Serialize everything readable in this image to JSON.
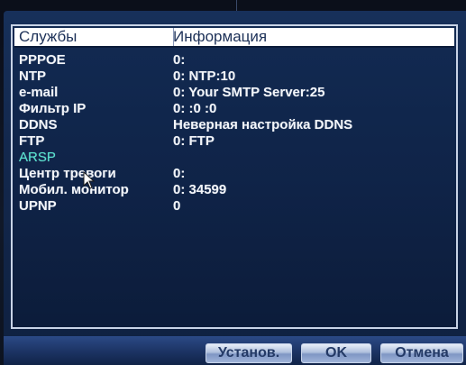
{
  "table": {
    "headers": {
      "service": "Службы",
      "info": "Информация"
    },
    "rows": [
      {
        "service": "PPPOE",
        "info": "0:"
      },
      {
        "service": "NTP",
        "info": "0: NTP:10"
      },
      {
        "service": "e-mail",
        "info": "0: Your SMTP Server:25"
      },
      {
        "service": "Фильтр IP",
        "info": "0: :0 :0"
      },
      {
        "service": "DDNS",
        "info": "Неверная настройка DDNS"
      },
      {
        "service": "FTP",
        "info": "0: FTP"
      },
      {
        "service": "ARSP",
        "info": ""
      },
      {
        "service": "Центр тревоги",
        "info": "0:"
      },
      {
        "service": "Мобил. монитор",
        "info": "0: 34599"
      },
      {
        "service": "UPNP",
        "info": "0"
      }
    ],
    "highlighted_row": "ARSP"
  },
  "buttons": {
    "install": "Установ.",
    "ok": "OK",
    "cancel": "Отмена"
  },
  "colors": {
    "panel": "#13284d",
    "text": "#f2f5fa",
    "highlight_text": "#56e6d2",
    "header_bg": "#ffffff"
  }
}
